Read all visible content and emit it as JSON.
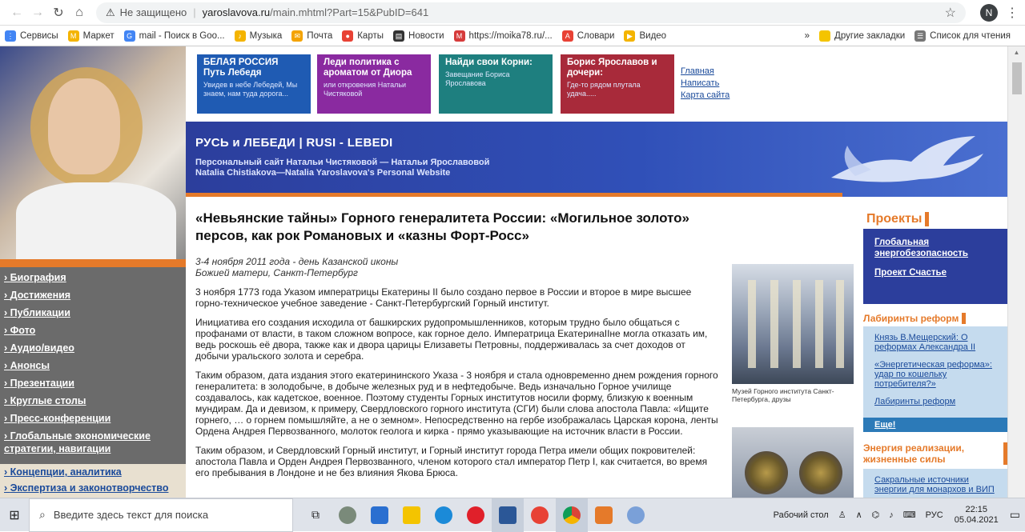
{
  "browser": {
    "security": "Не защищено",
    "host": "yaroslavova.ru",
    "path": "/main.mhtml?Part=15&PubID=641",
    "profile": "N"
  },
  "bookmarks": [
    {
      "label": "Сервисы",
      "color": "#4285f4"
    },
    {
      "label": "Маркет",
      "color": "#f4b400"
    },
    {
      "label": "mail - Поиск в Goo...",
      "color": "#4285f4"
    },
    {
      "label": "Музыка",
      "color": "#f4b400"
    },
    {
      "label": "Почта",
      "color": "#f4a300"
    },
    {
      "label": "Карты",
      "color": "#e84235"
    },
    {
      "label": "Новости",
      "color": "#333333"
    },
    {
      "label": "https://moika78.ru/...",
      "color": "#d63b3b"
    },
    {
      "label": "Словари",
      "color": "#e84235"
    },
    {
      "label": "Видео",
      "color": "#f4b400"
    }
  ],
  "bookmarks_right": {
    "more": "»",
    "other": "Другие закладки",
    "reading": "Список для чтения"
  },
  "tiles": [
    {
      "title": "БЕЛАЯ РОССИЯ\nПуть Лебедя",
      "sub": "Увидев в небе Лебедей, Мы знаем, нам туда дорога...",
      "color": "#1f5bb3"
    },
    {
      "title": "Леди политика с ароматом от Диора",
      "sub": "или откровения Натальи Чистяковой",
      "color": "#8a2aa0"
    },
    {
      "title": "Найди свои Корни:",
      "sub": "Завещание Бориса Ярославова",
      "color": "#1e7f7f"
    },
    {
      "title": "Борис Ярославов и дочери:",
      "sub": "Где-то рядом плутала удача.....",
      "color": "#a82a3a"
    }
  ],
  "top_links": [
    "Главная",
    "Написать",
    "Карта сайта"
  ],
  "banner": {
    "title": "РУСЬ и ЛЕБЕДИ | RUSI - LEBEDI",
    "sub1": "Персональный сайт Натальи Чистяковой — Натальи Ярославовой",
    "sub2": "Natalia Chistiakova—Natalia Yaroslavova's  Personal Website"
  },
  "left_menu": [
    "Биография",
    "Достижения",
    "Публикации",
    "Фото",
    "Аудио/видео",
    "Анонсы",
    "Презентации",
    "Круглые столы",
    "Пресс-конференции",
    "Глобальные экономические стратегии, навигации"
  ],
  "left_menu2": [
    "Концепции, аналитика",
    "Экспертиза и законотворчество"
  ],
  "article": {
    "title": "«Невьянские тайны» Горного генералитета России: «Могильное золото» персов, как рок Романовых и «казны Форт-Росс»",
    "date": "3-4 ноября 2011 года - день Казанской иконы Божией матери, Санкт-Петербург",
    "paragraphs": [
      "3 ноября 1773 года Указом императрицы Екатерины II было создано первое в России и второе в мире высшее горно-техническое учебное заведение - Санкт-Петербургский Горный институт.",
      "Инициатива его создания исходила от башкирских рудопромышленников, которым трудно было общаться с профанами от власти, в таком сложном вопросе, как горное дело. Императрица ЕкатеринаIIне могла отказать им, ведь роскошь её двора, также как и двора царицы Елизаветы Петровны, поддерживалась за счет доходов от добычи уральского золота и серебра.",
      "Таким образом, дата издания этого екатерининского Указа - 3 ноября и стала одновременно днем рождения горного генералитета: в золодобыче, в добыче железных руд и в нефтедобыче. Ведь изначально Горное училище создавалось, как кадетское, военное. Поэтому студенты Горных институтов носили форму, близкую к военным мундирам. Да и девизом, к примеру, Свердловского горного института (СГИ) были слова апостола Павла: «Ищите горнего, … о горнем помышляйте, а не о земном». Непосредственно на гербе изображалась Царская корона, ленты Ордена Андрея Первозванного, молоток геолога и кирка - прямо указывающие на источник власти в России.",
      "Таким образом, и Свердловский Горный институт, и Горный институт города Петра имели общих покровителей: апостола Павла и Орден Андрея Первозванного, членом которого стал император Петр I, как считается, во время его пребывания в Лондоне и не без влияния Якова Брюса."
    ],
    "caption": "Музей Горного института Санкт-Петербурга, друзы"
  },
  "right": {
    "projects_title": "Проекты",
    "projects": [
      "Глобальная энергобезопасность",
      "Проект Счастье"
    ],
    "reforms_title": "Лабиринты реформ",
    "reforms": [
      "Князь В.Мещерский: О реформах Александра II",
      "«Энергетическая реформа»: удар по кошельку потребителя?»",
      "Лабиринты реформ"
    ],
    "more": "Еще!",
    "energy_title": "Энергия реализации, жизненные силы",
    "energy": [
      "Сакральные источники энергии для монархов и ВИП"
    ]
  },
  "taskbar": {
    "search_placeholder": "Введите здесь текст для поиска",
    "desktop": "Рабочий стол",
    "lang": "РУС",
    "time": "22:15",
    "date": "05.04.2021"
  }
}
